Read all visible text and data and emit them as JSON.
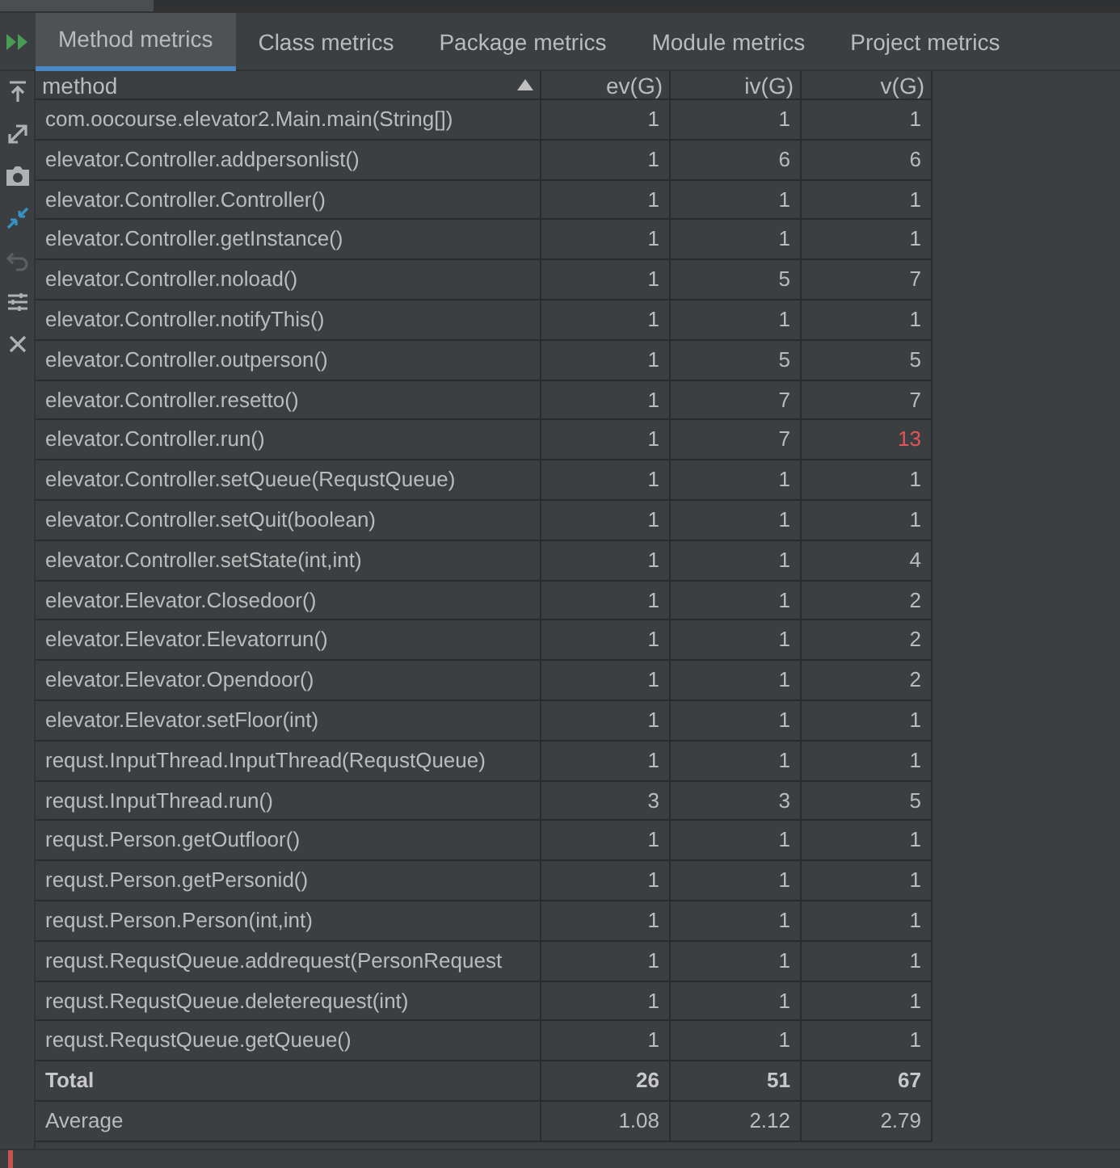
{
  "tabs": [
    {
      "label": "Method metrics",
      "selected": true
    },
    {
      "label": "Class metrics",
      "selected": false
    },
    {
      "label": "Package metrics",
      "selected": false
    },
    {
      "label": "Module metrics",
      "selected": false
    },
    {
      "label": "Project metrics",
      "selected": false
    }
  ],
  "table": {
    "columns": [
      "method",
      "ev(G)",
      "iv(G)",
      "v(G)"
    ],
    "rows": [
      {
        "cells": [
          "com.oocourse.elevator2.Main.main(String[])",
          "1",
          "1",
          "1"
        ],
        "v_exceeds": false
      },
      {
        "cells": [
          "elevator.Controller.addpersonlist()",
          "1",
          "6",
          "6"
        ],
        "v_exceeds": false
      },
      {
        "cells": [
          "elevator.Controller.Controller()",
          "1",
          "1",
          "1"
        ],
        "v_exceeds": false
      },
      {
        "cells": [
          "elevator.Controller.getInstance()",
          "1",
          "1",
          "1"
        ],
        "v_exceeds": false
      },
      {
        "cells": [
          "elevator.Controller.noload()",
          "1",
          "5",
          "7"
        ],
        "v_exceeds": false
      },
      {
        "cells": [
          "elevator.Controller.notifyThis()",
          "1",
          "1",
          "1"
        ],
        "v_exceeds": false
      },
      {
        "cells": [
          "elevator.Controller.outperson()",
          "1",
          "5",
          "5"
        ],
        "v_exceeds": false
      },
      {
        "cells": [
          "elevator.Controller.resetto()",
          "1",
          "7",
          "7"
        ],
        "v_exceeds": false
      },
      {
        "cells": [
          "elevator.Controller.run()",
          "1",
          "7",
          "13"
        ],
        "v_exceeds": true
      },
      {
        "cells": [
          "elevator.Controller.setQueue(RequstQueue)",
          "1",
          "1",
          "1"
        ],
        "v_exceeds": false
      },
      {
        "cells": [
          "elevator.Controller.setQuit(boolean)",
          "1",
          "1",
          "1"
        ],
        "v_exceeds": false
      },
      {
        "cells": [
          "elevator.Controller.setState(int,int)",
          "1",
          "1",
          "4"
        ],
        "v_exceeds": false
      },
      {
        "cells": [
          "elevator.Elevator.Closedoor()",
          "1",
          "1",
          "2"
        ],
        "v_exceeds": false
      },
      {
        "cells": [
          "elevator.Elevator.Elevatorrun()",
          "1",
          "1",
          "2"
        ],
        "v_exceeds": false
      },
      {
        "cells": [
          "elevator.Elevator.Opendoor()",
          "1",
          "1",
          "2"
        ],
        "v_exceeds": false
      },
      {
        "cells": [
          "elevator.Elevator.setFloor(int)",
          "1",
          "1",
          "1"
        ],
        "v_exceeds": false
      },
      {
        "cells": [
          "requst.InputThread.InputThread(RequstQueue)",
          "1",
          "1",
          "1"
        ],
        "v_exceeds": false
      },
      {
        "cells": [
          "requst.InputThread.run()",
          "3",
          "3",
          "5"
        ],
        "v_exceeds": false
      },
      {
        "cells": [
          "requst.Person.getOutfloor()",
          "1",
          "1",
          "1"
        ],
        "v_exceeds": false
      },
      {
        "cells": [
          "requst.Person.getPersonid()",
          "1",
          "1",
          "1"
        ],
        "v_exceeds": false
      },
      {
        "cells": [
          "requst.Person.Person(int,int)",
          "1",
          "1",
          "1"
        ],
        "v_exceeds": false
      },
      {
        "cells": [
          "requst.RequstQueue.addrequest(PersonRequest",
          "1",
          "1",
          "1"
        ],
        "v_exceeds": false
      },
      {
        "cells": [
          "requst.RequstQueue.deleterequest(int)",
          "1",
          "1",
          "1"
        ],
        "v_exceeds": false
      },
      {
        "cells": [
          "requst.RequstQueue.getQueue()",
          "1",
          "1",
          "1"
        ],
        "v_exceeds": false
      }
    ],
    "summary": [
      {
        "kind": "total",
        "cells": [
          "Total",
          "26",
          "51",
          "67"
        ]
      },
      {
        "kind": "average",
        "cells": [
          "Average",
          "1.08",
          "2.12",
          "2.79"
        ]
      }
    ]
  }
}
